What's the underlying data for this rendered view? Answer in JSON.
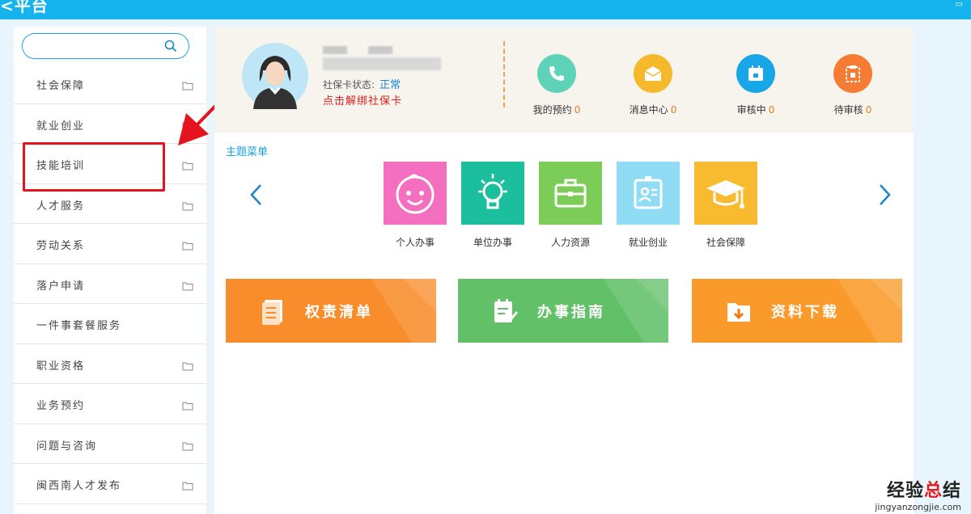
{
  "app": {
    "title": "<平台"
  },
  "search": {
    "placeholder": ""
  },
  "sidebar": {
    "items": [
      {
        "label": "社会保障",
        "has_folder": true
      },
      {
        "label": "就业创业",
        "has_folder": true
      },
      {
        "label": "技能培训",
        "has_folder": true
      },
      {
        "label": "人才服务",
        "has_folder": true
      },
      {
        "label": "劳动关系",
        "has_folder": true
      },
      {
        "label": "落户申请",
        "has_folder": true
      },
      {
        "label": "一件事套餐服务",
        "has_folder": false
      },
      {
        "label": "职业资格",
        "has_folder": true
      },
      {
        "label": "业务预约",
        "has_folder": true
      },
      {
        "label": "问题与咨询",
        "has_folder": true
      },
      {
        "label": "闽西南人才发布",
        "has_folder": true
      }
    ]
  },
  "profile": {
    "status_label": "社保卡状态:",
    "status_value": "正常",
    "bind_link": "点击解绑社保卡",
    "stats": [
      {
        "label": "我的预约",
        "count": "0",
        "icon": "phone-icon",
        "color": "#5fd3b7"
      },
      {
        "label": "消息中心",
        "count": "0",
        "icon": "mail-icon",
        "color": "#f5b92b"
      },
      {
        "label": "审核中",
        "count": "0",
        "icon": "calendar-icon",
        "color": "#17a6e8"
      },
      {
        "label": "待审核",
        "count": "0",
        "icon": "clipboard-icon",
        "color": "#f57c32"
      }
    ]
  },
  "theme": {
    "title": "主题菜单",
    "tiles": [
      {
        "label": "个人办事",
        "icon": "baby-face-icon",
        "color": "#f46fbf"
      },
      {
        "label": "单位办事",
        "icon": "lightbulb-icon",
        "color": "#1bbf9d"
      },
      {
        "label": "人力资源",
        "icon": "briefcase-icon",
        "color": "#7ccd57"
      },
      {
        "label": "就业创业",
        "icon": "id-badge-icon",
        "color": "#8fdcf4"
      },
      {
        "label": "社会保障",
        "icon": "graduation-cap-icon",
        "color": "#f8ba2e"
      }
    ]
  },
  "banners": [
    {
      "label": "权责清单",
      "icon": "document-list-icon",
      "color": "#f98d2c"
    },
    {
      "label": "办事指南",
      "icon": "guide-pen-icon",
      "color": "#62c069"
    },
    {
      "label": "资料下载",
      "icon": "download-folder-icon",
      "color": "#fa9a2a"
    }
  ],
  "watermark": {
    "part1": "经验",
    "part2": "总",
    "part3": "结",
    "url": "jingyanzongjie.com"
  }
}
